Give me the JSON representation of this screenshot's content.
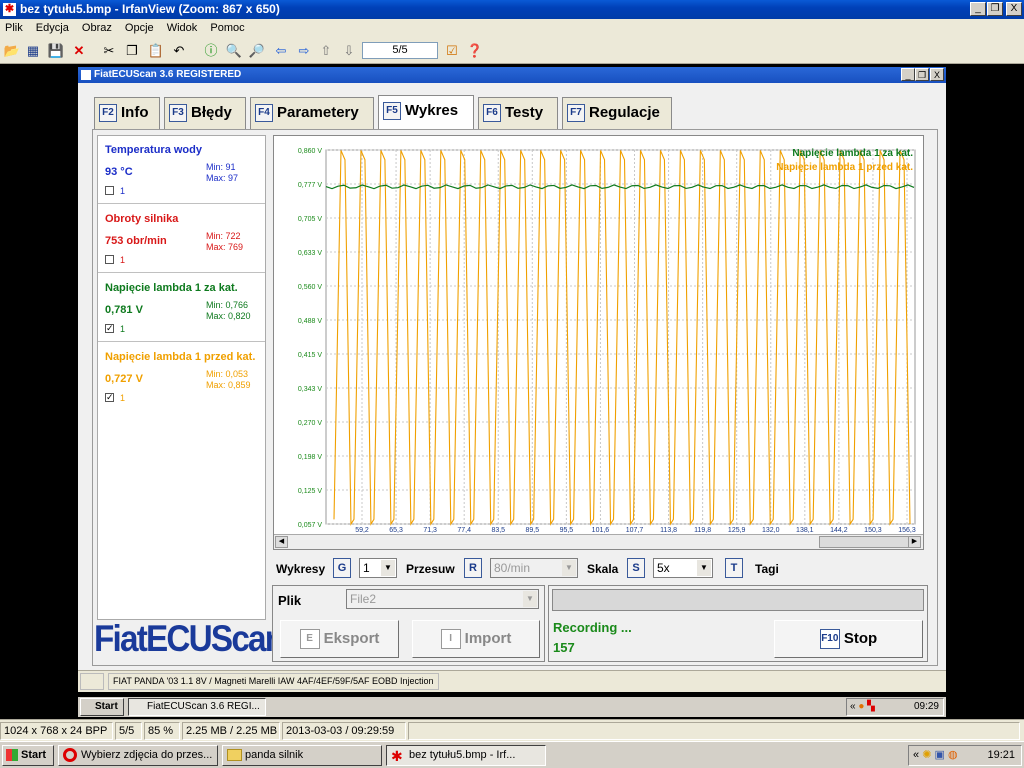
{
  "window": {
    "title": "bez tytułu5.bmp - IrfanView (Zoom: 867 x 650)",
    "controls": [
      "_",
      "❐",
      "X"
    ]
  },
  "menu": [
    "Plik",
    "Edycja",
    "Obraz",
    "Opcje",
    "Widok",
    "Pomoc"
  ],
  "toolbar": {
    "page": "5/5"
  },
  "app": {
    "title": "FiatECUScan 3.6 REGISTERED",
    "controls": [
      "_",
      "❐",
      "X"
    ],
    "tabs": [
      {
        "key": "F2",
        "label": "Info"
      },
      {
        "key": "F3",
        "label": "Błędy"
      },
      {
        "key": "F4",
        "label": "Parametery"
      },
      {
        "key": "F5",
        "label": "Wykres"
      },
      {
        "key": "F6",
        "label": "Testy"
      },
      {
        "key": "F7",
        "label": "Regulacje"
      }
    ],
    "active_tab": "Wykres",
    "sensors": [
      {
        "name": "Temperatura wody",
        "value": "93 °C",
        "min": "Min: 91",
        "max": "Max: 97",
        "cb_label": "1",
        "checked": false,
        "color": "#1c2ec8"
      },
      {
        "name": "Obroty silnika",
        "value": "753 obr/min",
        "min": "Min: 722",
        "max": "Max: 769",
        "cb_label": "1",
        "checked": false,
        "color": "#d81818"
      },
      {
        "name": "Napięcie lambda 1 za kat.",
        "value": "0,781 V",
        "min": "Min: 0,766",
        "max": "Max: 0,820",
        "cb_label": "1",
        "checked": true,
        "color": "#0e7a1e"
      },
      {
        "name": "Napięcie lambda 1 przed kat.",
        "value": "0,727 V",
        "min": "Min: 0,053",
        "max": "Max: 0,859",
        "cb_label": "1",
        "checked": true,
        "color": "#f0a000"
      }
    ],
    "logo": "FiatECUScan",
    "controls_row": {
      "wykresy_label": "Wykresy",
      "wykresy_key": "G",
      "wykresy_value": "1",
      "przesuw_label": "Przesuw",
      "przesuw_key": "R",
      "przesuw_value": "80/min",
      "skala_label": "Skala",
      "skala_key": "S",
      "skala_value": "5x",
      "tagi_key": "T",
      "tagi_label": "Tagi"
    },
    "plik_label": "Plik",
    "plik_value": "File2",
    "eksport": {
      "key": "E",
      "label": "Eksport"
    },
    "import": {
      "key": "I",
      "label": "Import"
    },
    "recording_label": "Recording ...",
    "recording_count": "157",
    "stop": {
      "key": "F10",
      "label": "Stop"
    },
    "status": "FIAT PANDA '03 1.1 8V / Magneti Marelli IAW 4AF/4EF/59F/5AF EOBD Injection",
    "inner_taskbar": {
      "start": "Start",
      "task": "FiatECUScan 3.6 REGI...",
      "time": "09:29"
    }
  },
  "chart_data": {
    "type": "line",
    "y_ticks": [
      "0,860 V",
      "0,777 V",
      "0,705 V",
      "0,633 V",
      "0,560 V",
      "0,488 V",
      "0,415 V",
      "0,343 V",
      "0,270 V",
      "0,198 V",
      "0,125 V",
      "0,057 V"
    ],
    "x_ticks": [
      "59,2",
      "65,3",
      "71,3",
      "77,4",
      "83,5",
      "89,5",
      "95,5",
      "101,6",
      "107,7",
      "113,8",
      "119,8",
      "125,9",
      "132,0",
      "138,1",
      "144,2",
      "150,3",
      "156,3"
    ],
    "ylim": [
      0.057,
      0.86
    ],
    "xlim": [
      55,
      158
    ],
    "grid": true,
    "legend_position": "top-right",
    "series": [
      {
        "name": "Napięcie lambda 1 za kat.",
        "color": "#0e7a1e",
        "kind": "flat",
        "value": 0.781
      },
      {
        "name": "Napięcie lambda 1 przed kat.",
        "color": "#f0a000",
        "kind": "oscillating",
        "min": 0.057,
        "max": 0.859,
        "cycles": 29
      }
    ]
  },
  "irfanview_status": [
    "1024 x 768 x 24 BPP",
    "5/5",
    "85 %",
    "2.25 MB / 2.25 MB",
    "2013-03-03 / 09:29:59"
  ],
  "taskbar": {
    "start": "Start",
    "tasks": [
      "Wybierz zdjęcia do przes...",
      "panda silnik",
      "bez tytułu5.bmp - Irf..."
    ],
    "time": "19:21"
  }
}
